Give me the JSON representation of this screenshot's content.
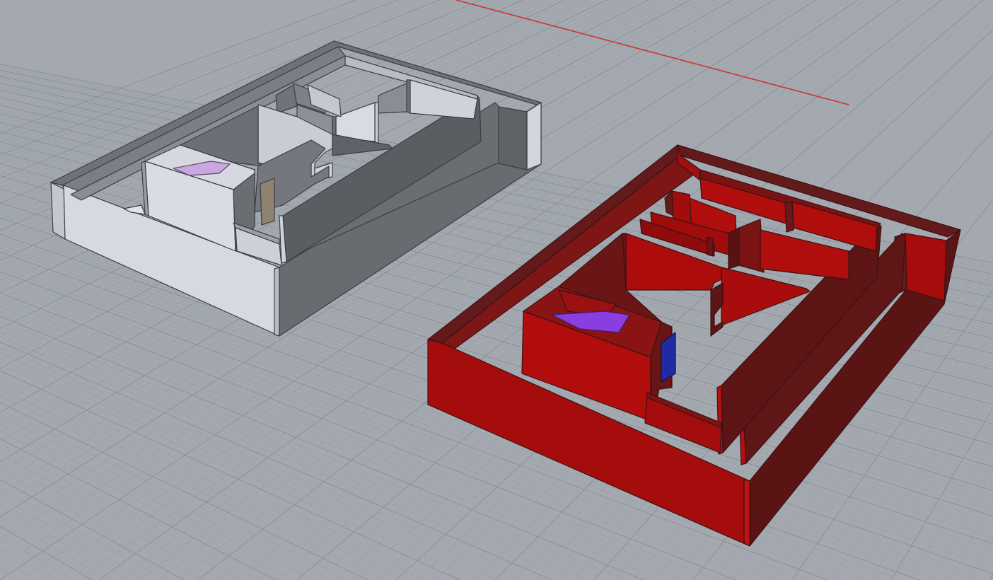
{
  "viewport": {
    "projection": "perspective",
    "display_mode": "shaded",
    "grid": true,
    "x_axis_color": "#d0312d"
  },
  "models": [
    {
      "name": "floor-plan-model-white",
      "wall_color": "#d8dbe3",
      "stair_color": "#c9a7df",
      "door_color": "#8d8370"
    },
    {
      "name": "floor-plan-model-red",
      "wall_color": "#b00d0d",
      "stair_color": "#8a3ee0",
      "door_color": "#1f2aa3"
    }
  ],
  "colors": {
    "background": "#a4a9b0",
    "grid_minor": "#9aa0a7",
    "grid_major": "#8b9097"
  }
}
